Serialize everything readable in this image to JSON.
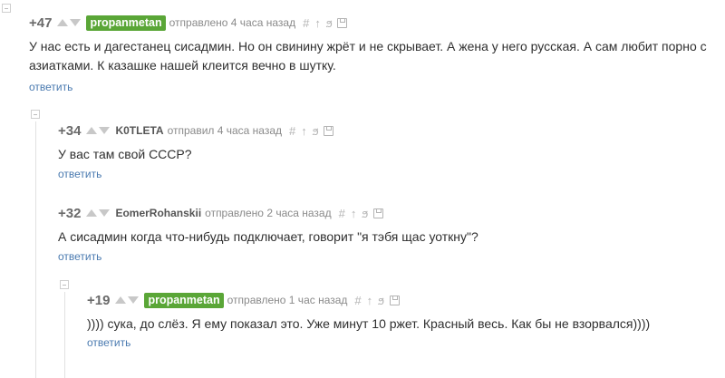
{
  "comments": [
    {
      "rating": "+47",
      "author": "propanmetan",
      "highlighted": true,
      "sent": "отправлено 4 часа назад",
      "text": "У нас есть и дагестанец сисадмин. Но он свинину жрёт и не скрывает. А жена у него русская. А сам любит порно с азиатками. К казашке нашей клеится вечно в шутку.",
      "reply": "ответить"
    },
    {
      "rating": "+34",
      "author": "K0TLETA",
      "highlighted": false,
      "sent": "отправил 4 часа назад",
      "text": "У вас там свой СССР?",
      "reply": "ответить"
    },
    {
      "rating": "+32",
      "author": "EomerRohanskii",
      "highlighted": false,
      "sent": "отправлено 2 часа назад",
      "text": "А сисадмин когда что-нибудь подключает, говорит \"я тэбя щас уоткну\"?",
      "reply": "ответить"
    },
    {
      "rating": "+19",
      "author": "propanmetan",
      "highlighted": true,
      "sent": "отправлено 1 час назад",
      "text": ")))) сука, до слёз. Я ему показал это. Уже минут 10 ржет. Красный весь. Как бы не взорвался))))",
      "reply": "ответить"
    }
  ],
  "icons": {
    "link": "#",
    "parent": "↑",
    "branch": "ϧ",
    "save": "save-icon"
  },
  "colors": {
    "author_highlight_bg": "#5aa637",
    "reply_link": "#4a7ab0",
    "meta": "#8a8a8a"
  }
}
